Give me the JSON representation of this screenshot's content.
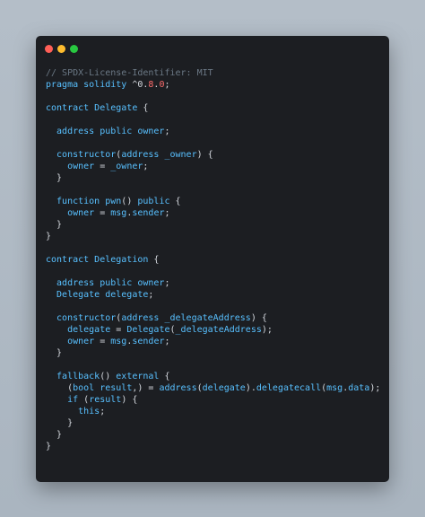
{
  "window": {
    "buttons": [
      {
        "name": "close-button",
        "color": "#ff5f57"
      },
      {
        "name": "minimize-button",
        "color": "#febc2e"
      },
      {
        "name": "zoom-button",
        "color": "#28c840"
      }
    ]
  },
  "colors": {
    "comment": "#6b7885",
    "default": "#58c0ff",
    "punct": "#d4d8de",
    "number": "#ff6d6d"
  },
  "code": [
    [
      [
        "comment",
        "// SPDX-License-Identifier: MIT"
      ]
    ],
    [
      [
        "default",
        "pragma solidity "
      ],
      [
        "punct",
        "^0."
      ],
      [
        "number",
        "8"
      ],
      [
        "punct",
        "."
      ],
      [
        "number",
        "0"
      ],
      [
        "punct",
        ";"
      ]
    ],
    [],
    [
      [
        "default",
        "contract Delegate "
      ],
      [
        "punct",
        "{"
      ]
    ],
    [],
    [
      [
        "default",
        "  address public owner"
      ],
      [
        "punct",
        ";"
      ]
    ],
    [],
    [
      [
        "default",
        "  constructor"
      ],
      [
        "punct",
        "("
      ],
      [
        "default",
        "address _owner"
      ],
      [
        "punct",
        ") {"
      ]
    ],
    [
      [
        "default",
        "    owner "
      ],
      [
        "punct",
        "="
      ],
      [
        "default",
        " _owner"
      ],
      [
        "punct",
        ";"
      ]
    ],
    [
      [
        "punct",
        "  }"
      ]
    ],
    [],
    [
      [
        "default",
        "  function pwn"
      ],
      [
        "punct",
        "()"
      ],
      [
        "default",
        " public "
      ],
      [
        "punct",
        "{"
      ]
    ],
    [
      [
        "default",
        "    owner "
      ],
      [
        "punct",
        "="
      ],
      [
        "default",
        " msg"
      ],
      [
        "punct",
        "."
      ],
      [
        "default",
        "sender"
      ],
      [
        "punct",
        ";"
      ]
    ],
    [
      [
        "punct",
        "  }"
      ]
    ],
    [
      [
        "punct",
        "}"
      ]
    ],
    [],
    [
      [
        "default",
        "contract Delegation "
      ],
      [
        "punct",
        "{"
      ]
    ],
    [],
    [
      [
        "default",
        "  address public owner"
      ],
      [
        "punct",
        ";"
      ]
    ],
    [
      [
        "default",
        "  Delegate delegate"
      ],
      [
        "punct",
        ";"
      ]
    ],
    [],
    [
      [
        "default",
        "  constructor"
      ],
      [
        "punct",
        "("
      ],
      [
        "default",
        "address _delegateAddress"
      ],
      [
        "punct",
        ") {"
      ]
    ],
    [
      [
        "default",
        "    delegate "
      ],
      [
        "punct",
        "="
      ],
      [
        "default",
        " Delegate"
      ],
      [
        "punct",
        "("
      ],
      [
        "default",
        "_delegateAddress"
      ],
      [
        "punct",
        ");"
      ]
    ],
    [
      [
        "default",
        "    owner "
      ],
      [
        "punct",
        "="
      ],
      [
        "default",
        " msg"
      ],
      [
        "punct",
        "."
      ],
      [
        "default",
        "sender"
      ],
      [
        "punct",
        ";"
      ]
    ],
    [
      [
        "punct",
        "  }"
      ]
    ],
    [],
    [
      [
        "default",
        "  fallback"
      ],
      [
        "punct",
        "()"
      ],
      [
        "default",
        " external "
      ],
      [
        "punct",
        "{"
      ]
    ],
    [
      [
        "punct",
        "    ("
      ],
      [
        "default",
        "bool result"
      ],
      [
        "punct",
        ",) = "
      ],
      [
        "default",
        "address"
      ],
      [
        "punct",
        "("
      ],
      [
        "default",
        "delegate"
      ],
      [
        "punct",
        ")."
      ],
      [
        "default",
        "delegatecall"
      ],
      [
        "punct",
        "("
      ],
      [
        "default",
        "msg"
      ],
      [
        "punct",
        "."
      ],
      [
        "default",
        "data"
      ],
      [
        "punct",
        ");"
      ]
    ],
    [
      [
        "default",
        "    if "
      ],
      [
        "punct",
        "("
      ],
      [
        "default",
        "result"
      ],
      [
        "punct",
        ") {"
      ]
    ],
    [
      [
        "default",
        "      this"
      ],
      [
        "punct",
        ";"
      ]
    ],
    [
      [
        "punct",
        "    }"
      ]
    ],
    [
      [
        "punct",
        "  }"
      ]
    ],
    [
      [
        "punct",
        "}"
      ]
    ]
  ]
}
